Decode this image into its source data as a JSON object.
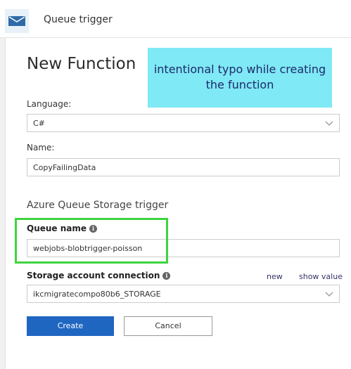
{
  "header": {
    "title": "Queue trigger",
    "icon": "envelope-icon"
  },
  "form": {
    "heading": "New Function",
    "language": {
      "label": "Language:",
      "value": "C#"
    },
    "name": {
      "label": "Name:",
      "value": "CopyFailingData"
    },
    "trigger_section": "Azure Queue Storage trigger",
    "queue_name": {
      "label": "Queue name",
      "value": "webjobs-blobtrigger-poisson"
    },
    "storage": {
      "label": "Storage account connection",
      "value": "ikcmigratecompo80b6_STORAGE",
      "new_link": "new",
      "show_value_link": "show value"
    },
    "create_label": "Create",
    "cancel_label": "Cancel"
  },
  "annotation": {
    "text": "intentional typo while creating the function"
  },
  "colors": {
    "primary_button": "#1f66c1",
    "highlight": "#3fd43f",
    "annotation_bg": "#7fe9f5"
  }
}
